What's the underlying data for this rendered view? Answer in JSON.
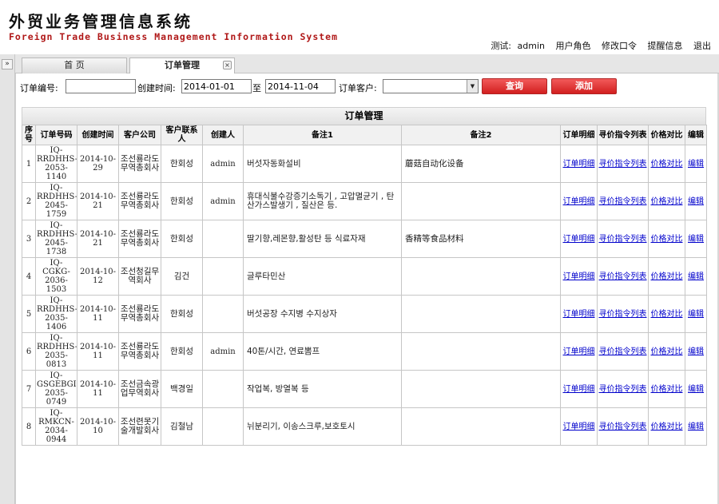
{
  "header": {
    "title_cn": "外贸业务管理信息系统",
    "title_en": "Foreign Trade Business Management Information System",
    "user_label": "测试:",
    "username": "admin",
    "links": [
      "用户角色",
      "修改口令",
      "提醒信息",
      "退出"
    ]
  },
  "sidebar": {
    "collapse_icon": "»"
  },
  "tabs": [
    {
      "label": "首    页"
    },
    {
      "label": "订单管理",
      "close_icon": "×"
    }
  ],
  "search": {
    "order_no_label": "订单编号:",
    "order_no_value": "",
    "created_label": "创建时间:",
    "date_from": "2014-01-01",
    "to_label": "至",
    "date_to": "2014-11-04",
    "customer_label": "订单客户:",
    "customer_value": "",
    "query_button": "查询",
    "add_button": "添加"
  },
  "table": {
    "title": "订单管理",
    "columns": [
      "序号",
      "订单号码",
      "创建时间",
      "客户公司",
      "客户联系人",
      "创建人",
      "备注1",
      "备注2",
      "订单明细",
      "寻价指令列表",
      "价格对比",
      "编辑"
    ],
    "rows": [
      {
        "no": "1",
        "order_no": "IQ-RRDHHS-2053-1140",
        "created": "2014-10-29",
        "company": "조선룡라도무역총회사",
        "contact": "한회성",
        "creator": "admin",
        "note1": "버섯자동화설비",
        "note2": "蘑菇自动化设备",
        "link_detail": "订单明细",
        "link_inquiry": "寻价指令列表",
        "link_compare": "价格对比",
        "link_edit": "编辑"
      },
      {
        "no": "2",
        "order_no": "IQ-RRDHHS-2045-1759",
        "created": "2014-10-21",
        "company": "조선룡라도무역총회사",
        "contact": "한회성",
        "creator": "admin",
        "note1": "휴대식불수강증기소독기 , 고압멸균기 , 탄산가스발생기 , 질산은 등.",
        "note2": "",
        "link_detail": "订单明细",
        "link_inquiry": "寻价指令列表",
        "link_compare": "价格对比",
        "link_edit": "编辑"
      },
      {
        "no": "3",
        "order_no": "IQ-RRDHHS-2045-1738",
        "created": "2014-10-21",
        "company": "조선룡라도무역총회사",
        "contact": "한회성",
        "creator": "",
        "note1": "딸기향,레몬향,활성탄 등 식료자재",
        "note2": "香精等食品材料",
        "link_detail": "订单明细",
        "link_inquiry": "寻价指令列表",
        "link_compare": "价格对比",
        "link_edit": "编辑"
      },
      {
        "no": "4",
        "order_no": "IQ-CGKG-2036-1503",
        "created": "2014-10-12",
        "company": "조선청길무역회사",
        "contact": "김건",
        "creator": "",
        "note1": "글루타민산",
        "note2": "",
        "link_detail": "订单明细",
        "link_inquiry": "寻价指令列表",
        "link_compare": "价格对比",
        "link_edit": "编辑"
      },
      {
        "no": "5",
        "order_no": "IQ-RRDHHS-2035-1406",
        "created": "2014-10-11",
        "company": "조선룡라도무역총회사",
        "contact": "한회성",
        "creator": "",
        "note1": "버섯공장 수지병 수지상자",
        "note2": "",
        "link_detail": "订单明细",
        "link_inquiry": "寻价指令列表",
        "link_compare": "价格对比",
        "link_edit": "编辑"
      },
      {
        "no": "6",
        "order_no": "IQ-RRDHHS-2035-0813",
        "created": "2014-10-11",
        "company": "조선룡라도무역총회사",
        "contact": "한회성",
        "creator": "admin",
        "note1": "40톤/시간, 연료뽐프",
        "note2": "",
        "link_detail": "订单明细",
        "link_inquiry": "寻价指令列表",
        "link_compare": "价格对比",
        "link_edit": "编辑"
      },
      {
        "no": "7",
        "order_no": "IQ-GSGEBGI-2035-0749",
        "created": "2014-10-11",
        "company": "조선금속광업무역회사",
        "contact": "백경일",
        "creator": "",
        "note1": "작업복, 방열복 등",
        "note2": "",
        "link_detail": "订单明细",
        "link_inquiry": "寻价指令列表",
        "link_compare": "价格对比",
        "link_edit": "编辑"
      },
      {
        "no": "8",
        "order_no": "IQ-RMKCN-2034-0944",
        "created": "2014-10-10",
        "company": "조선련못기술개발회사",
        "contact": "김철남",
        "creator": "",
        "note1": "뉘분리기, 이송스크루,보호토시",
        "note2": "",
        "link_detail": "订单明细",
        "link_inquiry": "寻价指令列表",
        "link_compare": "价格对比",
        "link_edit": "编辑"
      }
    ]
  }
}
